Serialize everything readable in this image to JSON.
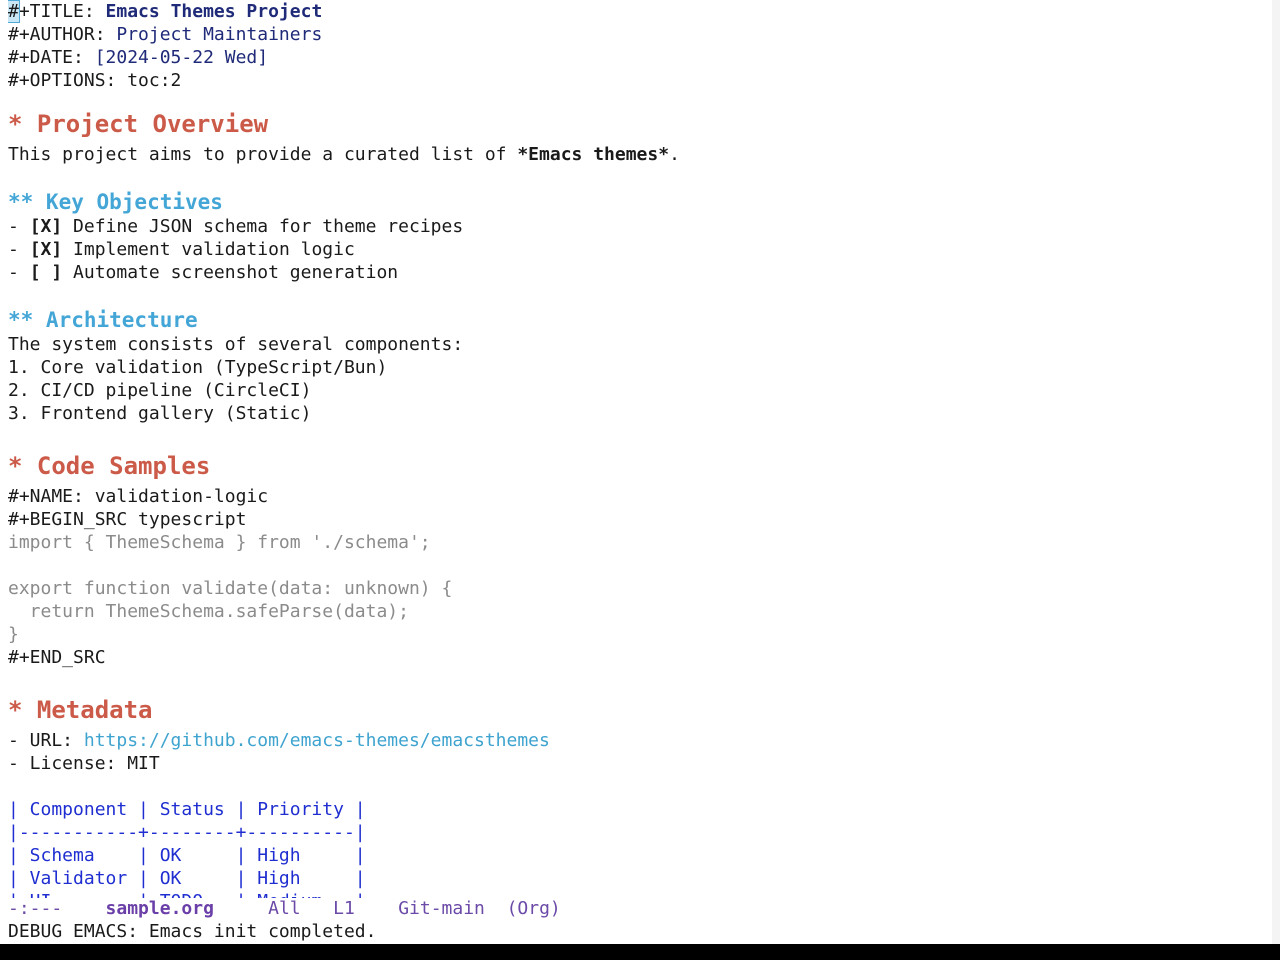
{
  "header": {
    "title_kw": "#+TITLE: ",
    "title_val": "Emacs Themes Project",
    "author_kw": "#+AUTHOR: ",
    "author_val": "Project Maintainers",
    "date_kw": "#+DATE: ",
    "date_val": "[2024-05-22 Wed]",
    "options": "#+OPTIONS: toc:2"
  },
  "overview": {
    "heading": "* Project Overview",
    "text_pre": "This project aims to provide a curated list of ",
    "text_bold": "*Emacs themes*",
    "text_post": "."
  },
  "objectives": {
    "heading": "** Key Objectives",
    "items": [
      {
        "prefix": "- ",
        "box": "[X]",
        "text": " Define JSON schema for theme recipes"
      },
      {
        "prefix": "- ",
        "box": "[X]",
        "text": " Implement validation logic"
      },
      {
        "prefix": "- ",
        "box": "[ ]",
        "text": " Automate screenshot generation"
      }
    ]
  },
  "architecture": {
    "heading": "** Architecture",
    "intro": "The system consists of several components:",
    "items": [
      "1. Core validation (TypeScript/Bun)",
      "2. CI/CD pipeline (CircleCI)",
      "3. Frontend gallery (Static)"
    ]
  },
  "code": {
    "heading": "* Code Samples",
    "name": "#+NAME: validation-logic",
    "begin": "#+BEGIN_SRC typescript",
    "lines": [
      "import { ThemeSchema } from './schema';",
      "",
      "export function validate(data: unknown) {",
      "  return ThemeSchema.safeParse(data);",
      "}"
    ],
    "end": "#+END_SRC"
  },
  "metadata": {
    "heading": "* Metadata",
    "url_label": "- URL: ",
    "url": "https://github.com/emacs-themes/emacsthemes",
    "license": "- License: MIT"
  },
  "table": {
    "rows": [
      "| Component | Status | Priority |",
      "|-----------+--------+----------|",
      "| Schema    | OK     | High     |",
      "| Validator | OK     | High     |",
      "| UI        | TODO   | Medium   |"
    ]
  },
  "modeline": {
    "status": "-:---",
    "buffer": "sample.org",
    "position": "All",
    "line": "L1",
    "vc": "Git-main",
    "mode": "(Org)"
  },
  "echo": "DEBUG EMACS: Emacs init completed.",
  "colors": {
    "heading1": "#cc5a48",
    "heading2": "#44a6d6",
    "keyword_value": "#1f2a78",
    "source": "#8b8b8b",
    "link": "#3ea3cf",
    "table": "#1f2ed1",
    "modeline": "#6b4aa8"
  }
}
